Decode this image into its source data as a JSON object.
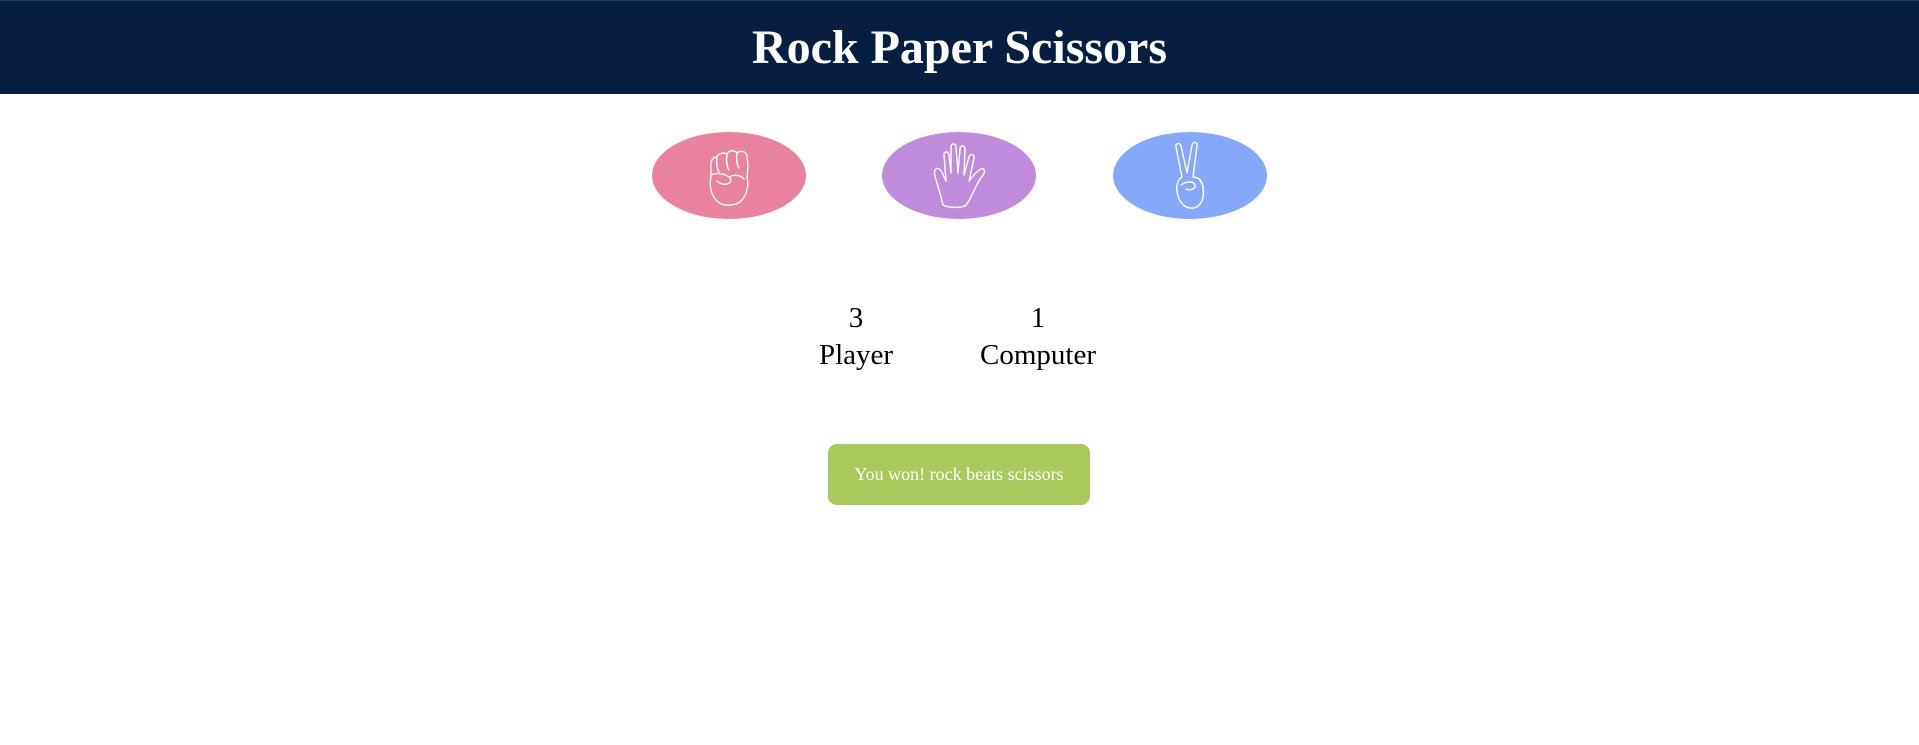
{
  "header": {
    "title": "Rock Paper Scissors",
    "background": "#061e40"
  },
  "choices": [
    {
      "id": "rock",
      "icon": "fist-icon",
      "color": "#e8829f"
    },
    {
      "id": "paper",
      "icon": "open-hand-icon",
      "color": "#c18bdb"
    },
    {
      "id": "scissors",
      "icon": "peace-hand-icon",
      "color": "#86a8fb"
    }
  ],
  "scores": {
    "player": {
      "value": "3",
      "label": "Player"
    },
    "computer": {
      "value": "1",
      "label": "Computer"
    }
  },
  "result": {
    "message": "You won! rock beats scissors",
    "color": "#a9c95c"
  }
}
